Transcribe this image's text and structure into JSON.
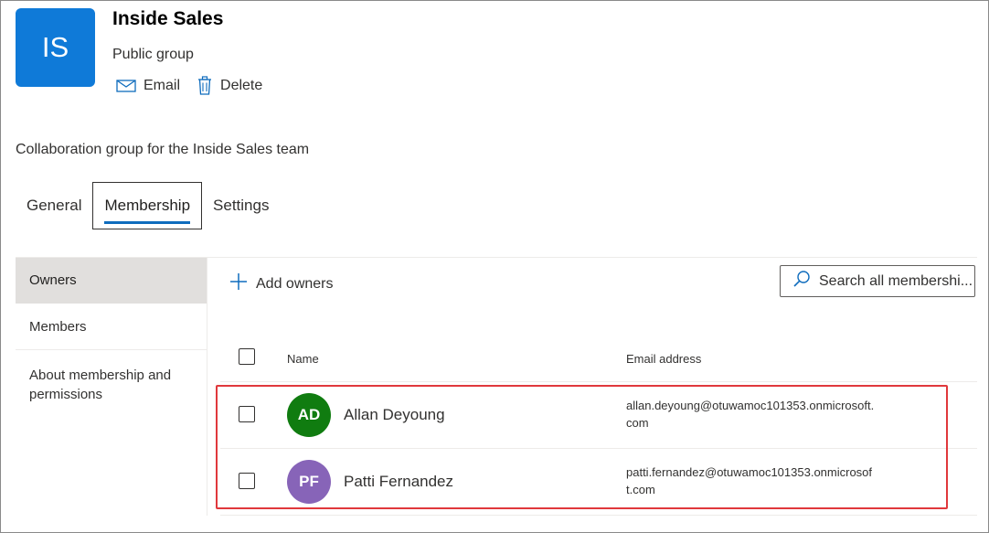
{
  "group": {
    "initials": "IS",
    "avatar_color": "#0f7ad8",
    "name": "Inside Sales",
    "type": "Public group",
    "description": "Collaboration group for the Inside Sales team"
  },
  "actions": {
    "email_label": "Email",
    "email_icon": "mail-icon",
    "delete_label": "Delete",
    "delete_icon": "trash-icon"
  },
  "tabs": [
    {
      "label": "General",
      "active": false
    },
    {
      "label": "Membership",
      "active": true
    },
    {
      "label": "Settings",
      "active": false
    }
  ],
  "sidenav": {
    "items": [
      {
        "label": "Owners",
        "active": true
      },
      {
        "label": "Members",
        "active": false
      },
      {
        "label": "About membership and permissions",
        "active": false
      }
    ]
  },
  "toolbar": {
    "add_owners_label": "Add owners",
    "add_icon": "plus-icon",
    "search_placeholder": "Search all membershi...",
    "search_icon": "search-icon"
  },
  "table": {
    "columns": [
      "Name",
      "Email address"
    ],
    "rows": [
      {
        "initials": "AD",
        "avatar_color": "#107c10",
        "name": "Allan Deyoung",
        "email_line1": "allan.deyoung@otuwamoc101353.onmicrosoft.",
        "email_line2": "com"
      },
      {
        "initials": "PF",
        "avatar_color": "#8764b8",
        "name": "Patti Fernandez",
        "email_line1": "patti.fernandez@otuwamoc101353.onmicrosof",
        "email_line2": "t.com"
      }
    ]
  },
  "colors": {
    "accent": "#0f6cbd",
    "highlight_border": "#e0383c"
  }
}
